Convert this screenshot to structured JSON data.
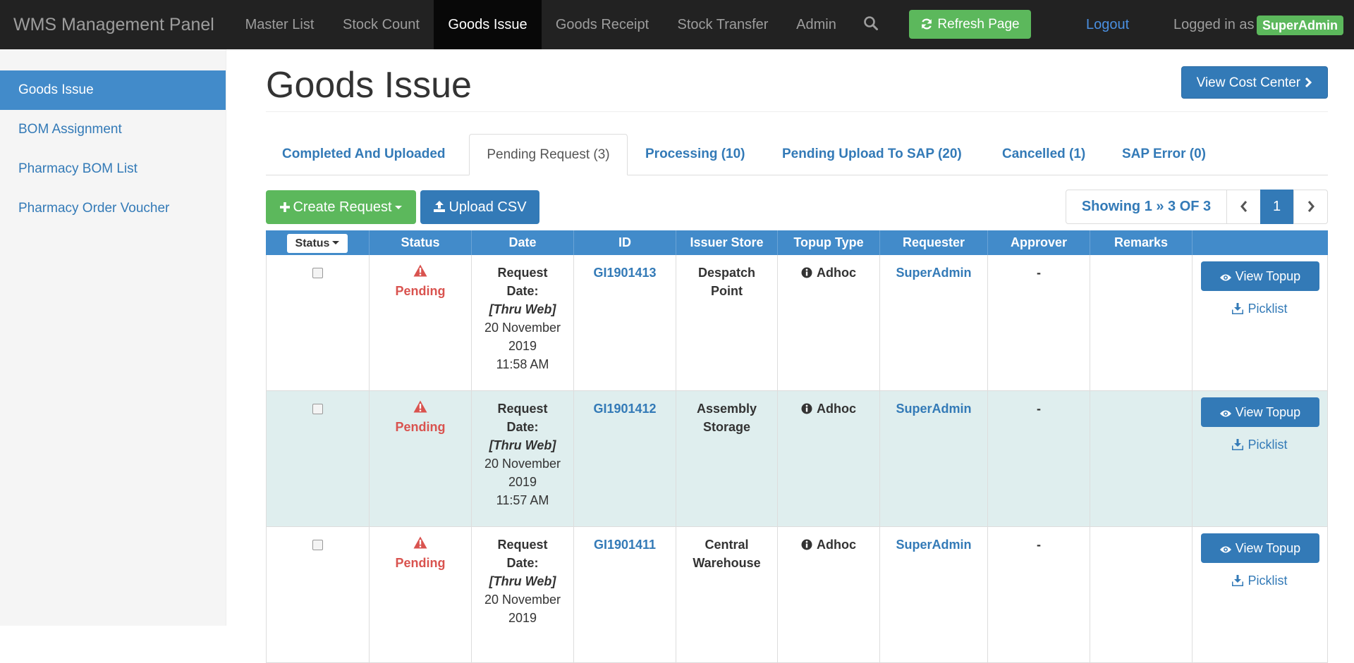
{
  "brand": "WMS Management Panel",
  "nav": {
    "items": [
      {
        "label": "Master List"
      },
      {
        "label": "Stock Count"
      },
      {
        "label": "Goods Issue",
        "active": true
      },
      {
        "label": "Goods Receipt"
      },
      {
        "label": "Stock Transfer"
      },
      {
        "label": "Admin"
      }
    ],
    "search_icon": "search-icon",
    "refresh_label": "Refresh Page",
    "logout_label": "Logout",
    "logged_in_label": "Logged in as",
    "user": "SuperAdmin"
  },
  "sidebar": {
    "items": [
      {
        "label": "Goods Issue",
        "active": true
      },
      {
        "label": "BOM Assignment"
      },
      {
        "label": "Pharmacy BOM List"
      },
      {
        "label": "Pharmacy Order Voucher"
      }
    ]
  },
  "page": {
    "title": "Goods Issue",
    "cost_center_label": "View Cost Center"
  },
  "tabs": [
    {
      "label": "Completed And Uploaded"
    },
    {
      "label": "Pending Request (3)",
      "active": true
    },
    {
      "label": "Processing (10)"
    },
    {
      "label": "Pending Upload To SAP (20)"
    },
    {
      "label": "Cancelled (1)"
    },
    {
      "label": "SAP Error (0)"
    }
  ],
  "toolbar": {
    "create_label": "Create Request",
    "upload_label": "Upload CSV"
  },
  "pagination": {
    "info": "Showing 1 » 3 OF 3",
    "current_page": "1"
  },
  "table": {
    "filter_label": "Status",
    "headers": [
      "Status",
      "Date",
      "ID",
      "Issuer Store",
      "Topup Type",
      "Requester",
      "Approver",
      "Remarks"
    ],
    "rows": [
      {
        "status": "Pending",
        "date_label_1": "Request",
        "date_label_2": "Date:",
        "date_via": "[Thru Web]",
        "date_day": "20 November",
        "date_year": "2019",
        "date_time": "11:58 AM",
        "id": "GI1901413",
        "store_1": "Despatch",
        "store_2": "Point",
        "topup": "Adhoc",
        "requester": "SuperAdmin",
        "approver": "-",
        "remarks": "",
        "view_label": "View Topup",
        "picklist_label": "Picklist"
      },
      {
        "status": "Pending",
        "date_label_1": "Request",
        "date_label_2": "Date:",
        "date_via": "[Thru Web]",
        "date_day": "20 November",
        "date_year": "2019",
        "date_time": "11:57 AM",
        "id": "GI1901412",
        "store_1": "Assembly",
        "store_2": "Storage",
        "topup": "Adhoc",
        "requester": "SuperAdmin",
        "approver": "-",
        "remarks": "",
        "view_label": "View Topup",
        "picklist_label": "Picklist"
      },
      {
        "status": "Pending",
        "date_label_1": "Request",
        "date_label_2": "Date:",
        "date_via": "[Thru Web]",
        "date_day": "20 November",
        "date_year": "2019",
        "date_time": "",
        "id": "GI1901411",
        "store_1": "Central",
        "store_2": "Warehouse",
        "topup": "Adhoc",
        "requester": "SuperAdmin",
        "approver": "-",
        "remarks": "",
        "view_label": "View Topup",
        "picklist_label": "Picklist"
      }
    ]
  },
  "colors": {
    "navbar": "#222222",
    "primary": "#337ab7",
    "success": "#5cb85c",
    "danger": "#d9534f",
    "table_header": "#428bca",
    "alt_row": "#dfeeee"
  }
}
